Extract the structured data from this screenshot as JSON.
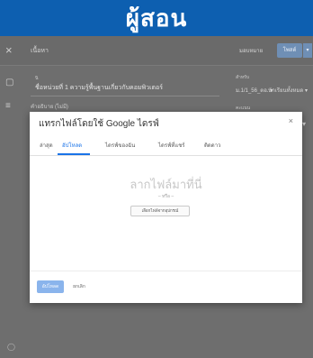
{
  "banner": {
    "title": "ผู้สอน"
  },
  "app": {
    "close_icon": "×",
    "top_label": "เนื้อหา",
    "assign_option": "มอบหมาย",
    "assign_button": "โพสต์",
    "assign_arrow": "▾",
    "title_small": "นิ",
    "title_value": "ชื่อหน่วยที่ 1 ความรู้พื้นฐานเกี่ยวกับคอมพิวเตอร์",
    "desc_label": "คำอธิบาย (ไม่มี)",
    "side_for": "สำหรับ",
    "side_class": "ม.1/1_56_ตอ.  ▾",
    "side_students": "นักเรียนทั้งหมด  ▾",
    "side_points": "คะแนน",
    "side_chevron": "▾",
    "left_icon_1": "▢",
    "left_icon_2": "≡",
    "bottom_icon": "◯"
  },
  "modal": {
    "title": "แทรกไฟล์โดยใช้ Google ไดรฟ์",
    "close_icon": "×",
    "tabs": [
      {
        "label": "ล่าสุด"
      },
      {
        "label": "อัปโหลด"
      },
      {
        "label": "ไดรฟ์ของฉัน"
      },
      {
        "label": "ไดรฟ์ที่แชร์"
      },
      {
        "label": "ติดดาว"
      }
    ],
    "drop_title": "ลากไฟล์มาที่นี่",
    "drop_or": "– หรือ –",
    "select_button": "เลือกไฟล์จากอุปกรณ์",
    "upload_button": "อัปโหลด",
    "cancel_button": "ยกเลิก"
  }
}
